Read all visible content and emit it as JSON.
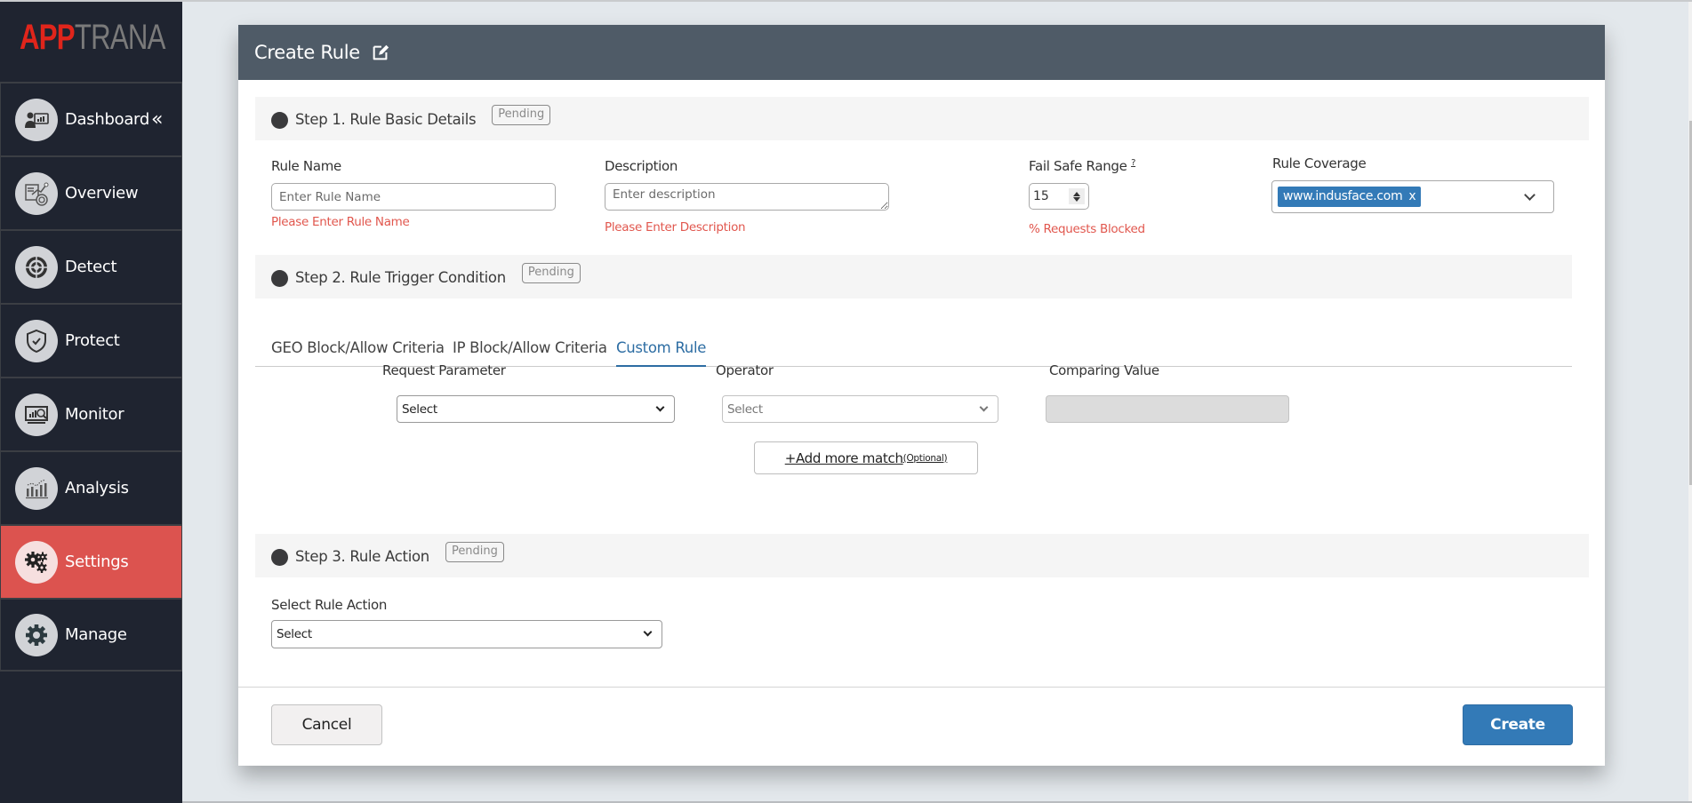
{
  "app": {
    "logo_primary": "APP",
    "logo_secondary": "TRANA",
    "brand_color": "#e0251b",
    "active_color": "#dc534f"
  },
  "sidebar": {
    "collapse_icon": "«",
    "items": [
      {
        "label": "Dashboard",
        "icon": "dashboard-icon",
        "active": false
      },
      {
        "label": "Overview",
        "icon": "overview-icon",
        "active": false
      },
      {
        "label": "Detect",
        "icon": "target-icon",
        "active": false
      },
      {
        "label": "Protect",
        "icon": "shield-icon",
        "active": false
      },
      {
        "label": "Monitor",
        "icon": "monitor-icon",
        "active": false
      },
      {
        "label": "Analysis",
        "icon": "analysis-icon",
        "active": false
      },
      {
        "label": "Settings",
        "icon": "gears-icon",
        "active": true
      },
      {
        "label": "Manage",
        "icon": "gear-icon",
        "active": false
      }
    ]
  },
  "dialog": {
    "title": "Create Rule",
    "title_icon": "edit-icon",
    "step1": {
      "title": "Step 1. Rule Basic Details",
      "status": "Pending",
      "rule_name": {
        "label": "Rule Name",
        "value": "",
        "placeholder": "Enter Rule Name",
        "error": "Please Enter Rule Name"
      },
      "description": {
        "label": "Description",
        "value": "",
        "placeholder": "Enter description",
        "error": "Please Enter Description"
      },
      "fail_safe": {
        "label": "Fail Safe Range",
        "help": "?",
        "value": "15",
        "hint": "% Requests Blocked"
      },
      "rule_coverage": {
        "label": "Rule Coverage",
        "selected": [
          "www.indusface.com"
        ],
        "remove_glyph": "x"
      }
    },
    "step2": {
      "title": "Step 2. Rule Trigger Condition",
      "status": "Pending",
      "tabs": [
        {
          "label": "GEO Block/Allow Criteria",
          "active": false
        },
        {
          "label": "IP Block/Allow Criteria",
          "active": false
        },
        {
          "label": "Custom Rule",
          "active": true
        }
      ],
      "request_parameter": {
        "label": "Request Parameter",
        "selected": "Select"
      },
      "operator": {
        "label": "Operator",
        "selected": "Select"
      },
      "comparing_value": {
        "label": "Comparing Value",
        "value": ""
      },
      "add_more": {
        "label": "+Add more match",
        "suffix": "(Optional)"
      }
    },
    "step3": {
      "title": "Step 3. Rule Action",
      "status": "Pending",
      "rule_action": {
        "label": "Select Rule Action",
        "selected": "Select"
      }
    },
    "footer": {
      "cancel_label": "Cancel",
      "create_label": "Create"
    }
  }
}
